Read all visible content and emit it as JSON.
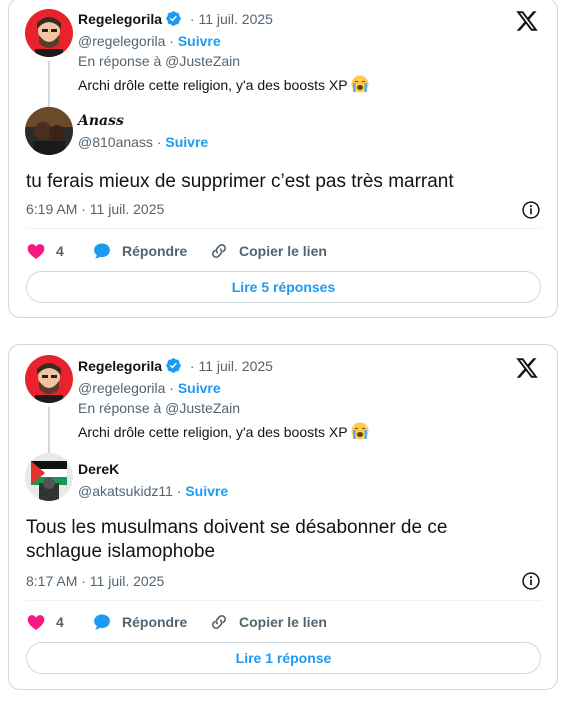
{
  "cards": [
    {
      "parent": {
        "name": "Regelegorila",
        "date": "· 11 juil. 2025",
        "handle": "@regelegorila",
        "sep": " · ",
        "follow": "Suivre",
        "reply_to": "En réponse à @JusteZain",
        "text": "Archi drôle cette religion, y'a des boosts XP"
      },
      "reply": {
        "name": "𝑨𝒏𝒂𝒔𝒔",
        "handle": "@810anass",
        "sep": " · ",
        "follow": "Suivre",
        "text": "tu ferais mieux de supprimer c’est pas très marrant",
        "time": "6:19 AM · 11 juil. 2025"
      },
      "actions": {
        "likes": "4",
        "reply": "Répondre",
        "copy": "Copier le lien"
      },
      "read_more": "Lire 5 réponses"
    },
    {
      "parent": {
        "name": "Regelegorila",
        "date": "· 11 juil. 2025",
        "handle": "@regelegorila",
        "sep": " · ",
        "follow": "Suivre",
        "reply_to": "En réponse à @JusteZain",
        "text": "Archi drôle cette religion, y'a des boosts XP"
      },
      "reply": {
        "name": "DereK",
        "handle": "@akatsukidz11",
        "sep": " · ",
        "follow": "Suivre",
        "text_line1": "Tous les musulmans doivent se désabonner de ce",
        "text_line2": "schlague islamophobe",
        "time": "8:17 AM · 11 juil. 2025"
      },
      "actions": {
        "likes": "4",
        "reply": "Répondre",
        "copy": "Copier le lien"
      },
      "read_more": "Lire 1 réponse"
    }
  ],
  "colors": {
    "accent": "#1d9bf0",
    "like": "#f91880",
    "muted": "#536471",
    "border": "#cfd9de"
  },
  "icons": [
    "x-logo-icon",
    "verified-badge-icon",
    "heart-icon",
    "reply-bubble-icon",
    "link-icon",
    "info-icon",
    "crying-face-emoji"
  ]
}
